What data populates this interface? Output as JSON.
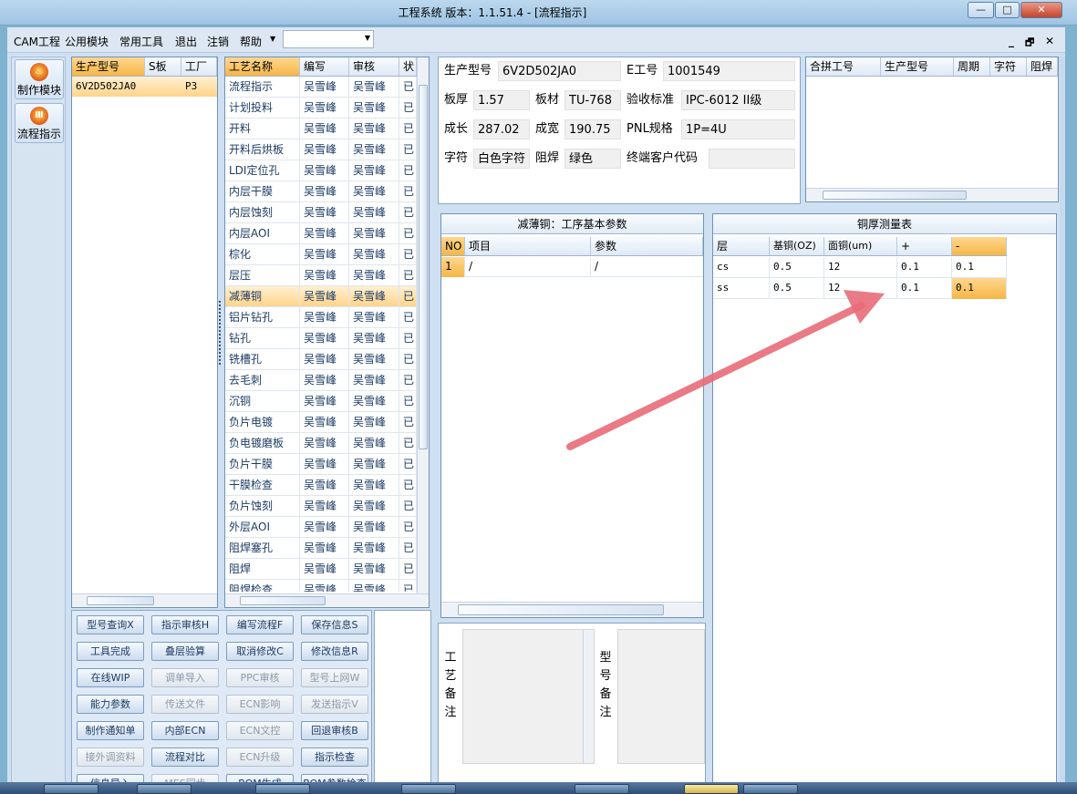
{
  "window": {
    "title": "工程系统   版本：1.1.51.4 - [流程指示]",
    "minimize": "—",
    "maximize": "□",
    "close": "✕"
  },
  "menu": {
    "items": [
      "CAM工程",
      "公用模块",
      "常用工具",
      "退出",
      "注销",
      "帮助"
    ],
    "combo_value": "",
    "mdi_min": "_",
    "mdi_restore": "🗗",
    "mdi_close": "✕"
  },
  "nav": [
    {
      "label": "制作模块",
      "icon": "fire-icon"
    },
    {
      "label": "流程指示",
      "icon": "gauge-icon"
    }
  ],
  "model_list": {
    "headers": [
      "生产型号",
      "S板",
      "工厂"
    ],
    "rows": [
      [
        "6V2D502JA0",
        "",
        "P3"
      ]
    ]
  },
  "process": {
    "headers": [
      "工艺名称",
      "编写",
      "审核",
      "状"
    ],
    "selected_index": 10,
    "rows": [
      [
        "流程指示",
        "吴雪峰",
        "吴雪峰",
        "已"
      ],
      [
        "计划投料",
        "吴雪峰",
        "吴雪峰",
        "已"
      ],
      [
        "开料",
        "吴雪峰",
        "吴雪峰",
        "已"
      ],
      [
        "开料后烘板",
        "吴雪峰",
        "吴雪峰",
        "已"
      ],
      [
        "LDI定位孔",
        "吴雪峰",
        "吴雪峰",
        "已"
      ],
      [
        "内层干膜",
        "吴雪峰",
        "吴雪峰",
        "已"
      ],
      [
        "内层蚀刻",
        "吴雪峰",
        "吴雪峰",
        "已"
      ],
      [
        "内层AOI",
        "吴雪峰",
        "吴雪峰",
        "已"
      ],
      [
        "棕化",
        "吴雪峰",
        "吴雪峰",
        "已"
      ],
      [
        "层压",
        "吴雪峰",
        "吴雪峰",
        "已"
      ],
      [
        "减薄铜",
        "吴雪峰",
        "吴雪峰",
        "已"
      ],
      [
        "铝片钻孔",
        "吴雪峰",
        "吴雪峰",
        "已"
      ],
      [
        "钻孔",
        "吴雪峰",
        "吴雪峰",
        "已"
      ],
      [
        "铣槽孔",
        "吴雪峰",
        "吴雪峰",
        "已"
      ],
      [
        "去毛刺",
        "吴雪峰",
        "吴雪峰",
        "已"
      ],
      [
        "沉铜",
        "吴雪峰",
        "吴雪峰",
        "已"
      ],
      [
        "负片电镀",
        "吴雪峰",
        "吴雪峰",
        "已"
      ],
      [
        "负电镀磨板",
        "吴雪峰",
        "吴雪峰",
        "已"
      ],
      [
        "负片干膜",
        "吴雪峰",
        "吴雪峰",
        "已"
      ],
      [
        "干膜检查",
        "吴雪峰",
        "吴雪峰",
        "已"
      ],
      [
        "负片蚀刻",
        "吴雪峰",
        "吴雪峰",
        "已"
      ],
      [
        "外层AOI",
        "吴雪峰",
        "吴雪峰",
        "已"
      ],
      [
        "阻焊塞孔",
        "吴雪峰",
        "吴雪峰",
        "已"
      ],
      [
        "阻焊",
        "吴雪峰",
        "吴雪峰",
        "已"
      ],
      [
        "阻焊检查",
        "吴雪峰",
        "吴雪峰",
        "已"
      ]
    ]
  },
  "info": {
    "model_label": "生产型号",
    "model": "6V2D502JA0",
    "e_label": "E工号",
    "e": "1001549",
    "thick_label": "板厚",
    "thick": "1.57",
    "material_label": "板材",
    "material": "TU-768",
    "std_label": "验收标准",
    "std": "IPC-6012 II级",
    "len_label": "成长",
    "len": "287.02",
    "wid_label": "成宽",
    "wid": "190.75",
    "pnl_label": "PNL规格",
    "pnl": "1P=4U",
    "char_label": "字符",
    "char": "白色字符",
    "mask_label": "阻焊",
    "mask": "绿色",
    "cust_label": "终端客户代码",
    "cust": ""
  },
  "merge": {
    "headers": [
      "合拼工号",
      "生产型号",
      "周期",
      "字符",
      "阻焊"
    ]
  },
  "step_params": {
    "title": "减薄铜：工序基本参数",
    "headers": [
      "NO",
      "项目",
      "参数"
    ],
    "rows": [
      [
        "1",
        "/",
        "/"
      ]
    ]
  },
  "copper": {
    "title": "铜厚测量表",
    "headers": [
      "层",
      "基铜(OZ)",
      "面铜(um)",
      "+",
      "-"
    ],
    "rows": [
      [
        "cs",
        "0.5",
        "12",
        "0.1",
        "0.1"
      ],
      [
        "ss",
        "0.5",
        "12",
        "0.1",
        "0.1"
      ]
    ]
  },
  "buttons": [
    [
      "型号查询X",
      true
    ],
    [
      "指示审核H",
      true
    ],
    [
      "编写流程F",
      true
    ],
    [
      "保存信息S",
      true
    ],
    [
      "工具完成",
      true
    ],
    [
      "叠层验算",
      true
    ],
    [
      "取消修改C",
      true
    ],
    [
      "修改信息R",
      true
    ],
    [
      "在线WIP",
      true
    ],
    [
      "调单导入",
      false
    ],
    [
      "PPC审核",
      false
    ],
    [
      "型号上网W",
      false
    ],
    [
      "能力参数",
      true
    ],
    [
      "传送文件",
      false
    ],
    [
      "ECN影响",
      false
    ],
    [
      "发送指示V",
      false
    ],
    [
      "制作通知单",
      true
    ],
    [
      "内部ECN",
      true
    ],
    [
      "ECN文控",
      false
    ],
    [
      "回退审核B",
      true
    ],
    [
      "接外调资料",
      false
    ],
    [
      "流程对比",
      true
    ],
    [
      "ECN升级",
      false
    ],
    [
      "指示检查",
      true
    ],
    [
      "信息导入",
      true
    ],
    [
      "MES同步",
      false
    ],
    [
      "BOM生成",
      true
    ],
    [
      "BOM参数检查",
      true
    ]
  ],
  "remarks": {
    "process_label": "工艺备注",
    "model_label": "型号备注"
  },
  "colors": {
    "accent": "#f5b646",
    "arrow": "#e86c78",
    "frame": "#7fb2cf"
  }
}
